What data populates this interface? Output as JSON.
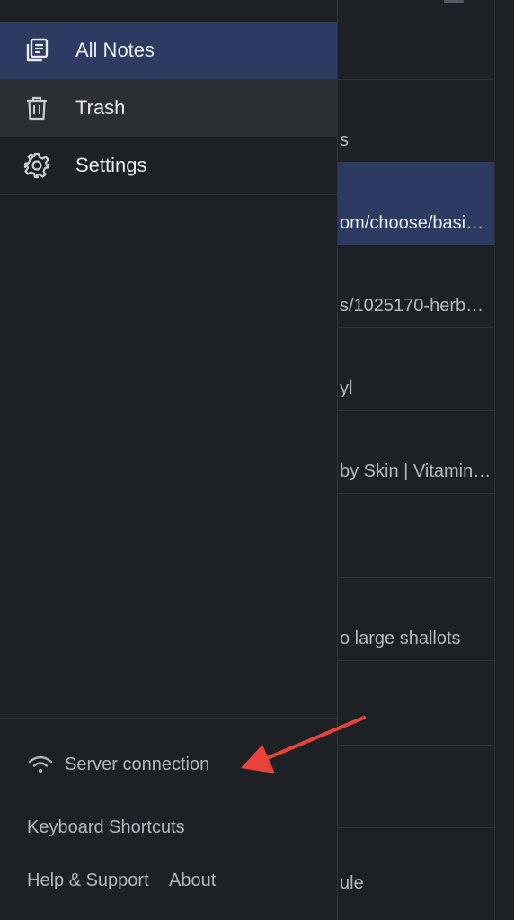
{
  "sidebar": {
    "nav": {
      "all_notes": "All Notes",
      "trash": "Trash",
      "settings": "Settings"
    },
    "footer": {
      "server_connection": "Server connection",
      "keyboard_shortcuts": "Keyboard Shortcuts",
      "help_support": "Help & Support",
      "about": "About"
    },
    "icons": {
      "all_notes": "notes-stack-icon",
      "trash": "trash-icon",
      "settings": "gear-icon",
      "server": "wifi-icon"
    }
  },
  "note_list": {
    "rows": [
      {
        "excerpt": "",
        "selected": false
      },
      {
        "excerpt": "s",
        "selected": false
      },
      {
        "excerpt": "om/choose/basi…",
        "selected": true
      },
      {
        "excerpt": "s/1025170-herb…",
        "selected": false
      },
      {
        "excerpt": "yl",
        "selected": false
      },
      {
        "excerpt": "by Skin | Vitamin…",
        "selected": false
      },
      {
        "excerpt": "",
        "selected": false
      },
      {
        "excerpt": "o large shallots",
        "selected": false
      },
      {
        "excerpt": "",
        "selected": false
      },
      {
        "excerpt": "",
        "selected": false
      },
      {
        "excerpt": "ule",
        "selected": false
      }
    ]
  },
  "colors": {
    "selected_bg": "#2d3a62",
    "sidebar_bg": "#1d2024",
    "annotation_arrow": "#e8433a"
  }
}
